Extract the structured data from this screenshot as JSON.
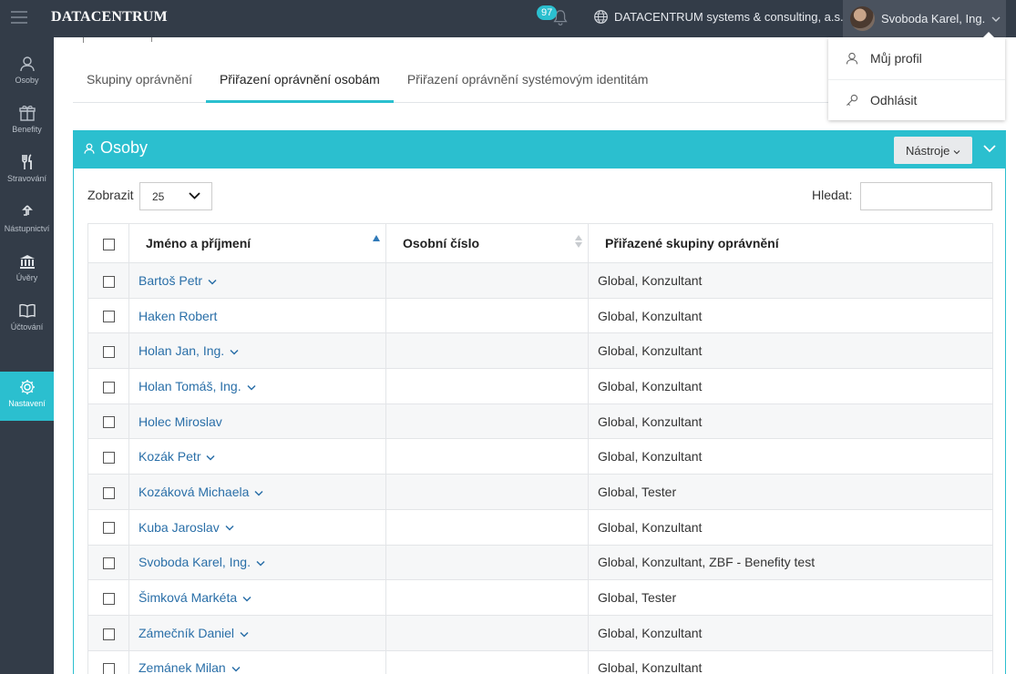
{
  "topbar": {
    "logo": "DATACENTRUM",
    "notification_count": "97",
    "organization": "DATACENTRUM systems & consulting, a.s.",
    "user_name": "Svoboda Karel, Ing."
  },
  "user_menu": {
    "items": [
      {
        "label": "Můj profil",
        "icon": "user-icon"
      },
      {
        "label": "Odhlásit",
        "icon": "key-icon"
      }
    ]
  },
  "sidebar": {
    "items": [
      {
        "label": "Osoby",
        "icon": "user-icon"
      },
      {
        "label": "Benefity",
        "icon": "gift-icon"
      },
      {
        "label": "Stravování",
        "icon": "cutlery-icon"
      },
      {
        "label": "Nástupnictví",
        "icon": "arrow-up-icon"
      },
      {
        "label": "Úvěry",
        "icon": "bank-icon"
      },
      {
        "label": "Účtování",
        "icon": "book-icon"
      },
      {
        "label": "Nastavení",
        "icon": "gear-icon",
        "active": true
      }
    ]
  },
  "tabs": [
    {
      "label": "Skupiny oprávnění"
    },
    {
      "label": "Přiřazení oprávnění osobám",
      "active": true
    },
    {
      "label": "Přiřazení oprávnění systémovým identitám"
    }
  ],
  "panel": {
    "title": "Osoby",
    "tools_label": "Nástroje",
    "show_label": "Zobrazit",
    "page_size": "25",
    "search_label": "Hledat:",
    "search_value": ""
  },
  "table": {
    "columns": [
      "Jméno a příjmení",
      "Osobní číslo",
      "Přiřazené skupiny oprávnění"
    ],
    "rows": [
      {
        "name": "Bartoš Petr",
        "number": "",
        "groups": "Global, Konzultant",
        "expandable": true
      },
      {
        "name": "Haken Robert",
        "number": "",
        "groups": "Global, Konzultant",
        "expandable": false
      },
      {
        "name": "Holan Jan, Ing.",
        "number": "",
        "groups": "Global, Konzultant",
        "expandable": true
      },
      {
        "name": "Holan Tomáš, Ing.",
        "number": "",
        "groups": "Global, Konzultant",
        "expandable": true
      },
      {
        "name": "Holec Miroslav",
        "number": "",
        "groups": "Global, Konzultant",
        "expandable": false
      },
      {
        "name": "Kozák Petr",
        "number": "",
        "groups": "Global, Konzultant",
        "expandable": true
      },
      {
        "name": "Kozáková Michaela",
        "number": "",
        "groups": "Global, Tester",
        "expandable": true
      },
      {
        "name": "Kuba Jaroslav",
        "number": "",
        "groups": "Global, Konzultant",
        "expandable": true
      },
      {
        "name": "Svoboda Karel, Ing.",
        "number": "",
        "groups": "Global, Konzultant, ZBF - Benefity test",
        "expandable": true
      },
      {
        "name": "Šimková Markéta",
        "number": "",
        "groups": "Global, Tester",
        "expandable": true
      },
      {
        "name": "Zámečník Daniel",
        "number": "",
        "groups": "Global, Konzultant",
        "expandable": true
      },
      {
        "name": "Zemánek Milan",
        "number": "",
        "groups": "Global, Konzultant",
        "expandable": true
      }
    ]
  },
  "colors": {
    "accent": "#2bbfcf",
    "sidebar_bg": "#333c48",
    "link": "#2a6fa8"
  }
}
